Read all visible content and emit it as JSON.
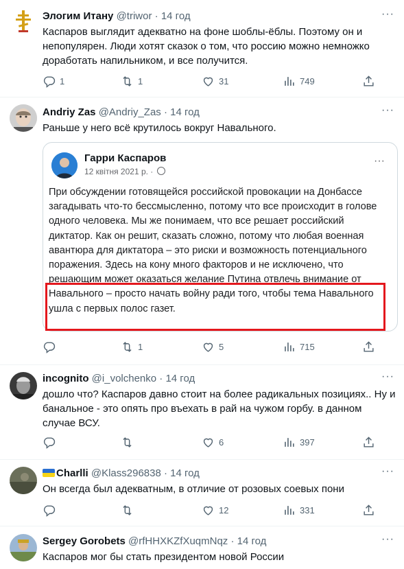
{
  "tweets": [
    {
      "name": "Элогим Итану",
      "handle": "@triwor",
      "time": "· 14 год",
      "text": "Каспаров выглядит адекватно на фоне шоблы-ёблы. Поэтому он и непопулярен. Люди хотят сказок о том, что россию можно немножко доработать напильником, и все получится.",
      "replies": "1",
      "retweets": "1",
      "likes": "31",
      "views": "749"
    },
    {
      "name": "Andriy Zas",
      "handle": "@Andriy_Zas",
      "time": "· 14 год",
      "text": "Раньше у него всё крутилось  вокруг Навального.",
      "replies": "",
      "retweets": "1",
      "likes": "5",
      "views": "715"
    },
    {
      "name": "incognito",
      "handle": "@i_volchenko",
      "time": "· 14 год",
      "text": "дошло что? Каспаров давно стоит на более радикальных позициях.. Ну и банальное - это опять про въехать в рай на чужом горбу. в данном случае ВСУ.",
      "replies": "",
      "retweets": "",
      "likes": "6",
      "views": "397"
    },
    {
      "name": "Charlli",
      "handle": "@Klass296838",
      "time": "· 14 год",
      "text": "Он всегда был адекватным, в отличие от розовых соевых пони",
      "replies": "",
      "retweets": "",
      "likes": "12",
      "views": "331"
    },
    {
      "name": "Sergey Gorobets",
      "handle": "@rfHHXKZfXuqmNqz",
      "time": "· 14 год",
      "text": "Каспаров мог бы стать президентом новой России"
    }
  ],
  "quote": {
    "author": "Гарри Каспаров",
    "date": "12 квітня 2021 р. ·",
    "text_before": "При обсуждении готовящейся российской провокации на Донбассе загадывать что-то бессмысленно, потому что все происходит в голове одного человека. Мы же понимаем, что все решает российский диктатор. Как он решит, сказать сложно, потому что любая военная авантюра для диктатора – это риски и возможность потенциального поражения. Здесь на кону много факторов и не исключено, что решающим может оказаться",
    "text_highlight": "желание Путина отвлечь внимание от Навального – просто начать войну ради того, чтобы тема Навального ушла с первых полос газет."
  },
  "icons": {
    "reply": "reply-icon",
    "retweet": "retweet-icon",
    "like": "heart-icon",
    "views": "views-icon",
    "share": "share-icon",
    "more": "more-icon",
    "flag": "ukraine-flag-icon",
    "globe": "globe-icon"
  },
  "colors": {
    "highlight_box": "#e4171d",
    "muted": "#536471"
  }
}
